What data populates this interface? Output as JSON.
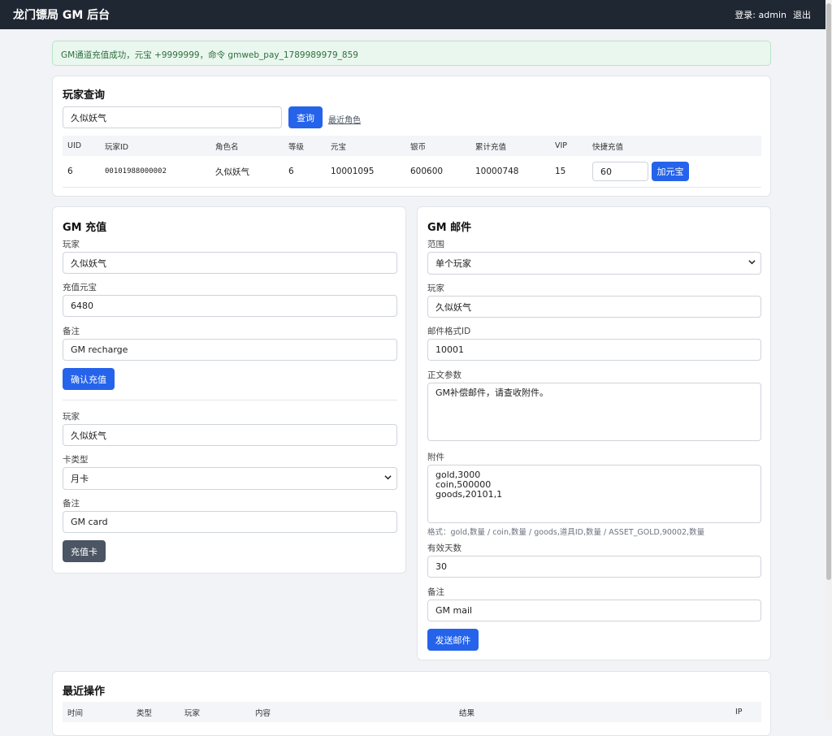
{
  "header": {
    "title": "龙门镖局 GM 后台",
    "login_prefix": "登录:",
    "user": "admin",
    "logout": "退出"
  },
  "alert": {
    "text": "GM通道充值成功，元宝 +9999999，命令 gmweb_pay_1789989979_859"
  },
  "player_query": {
    "title": "玩家查询",
    "search_value": "久似妖气",
    "search_button": "查询",
    "recent_link": "最近角色",
    "columns": [
      "UID",
      "玩家ID",
      "角色名",
      "等级",
      "元宝",
      "银币",
      "累计充值",
      "VIP",
      "快捷充值"
    ],
    "rows": [
      {
        "uid": "6",
        "player_id": "00101988000002",
        "name": "久似妖气",
        "level": "6",
        "yuanbao": "10001095",
        "silver": "600600",
        "total_recharge": "10000748",
        "vip": "15",
        "quick_value": "60",
        "quick_button": "加元宝"
      }
    ]
  },
  "gm_recharge": {
    "title": "GM 充值",
    "player_label": "玩家",
    "player_value": "久似妖气",
    "amount_label": "充值元宝",
    "amount_value": "6480",
    "note_label": "备注",
    "note_value": "GM recharge",
    "confirm_button": "确认充值",
    "card_player_label": "玩家",
    "card_player_value": "久似妖气",
    "card_type_label": "卡类型",
    "card_type_value": "月卡",
    "card_note_label": "备注",
    "card_note_value": "GM card",
    "card_button": "充值卡"
  },
  "gm_mail": {
    "title": "GM 邮件",
    "scope_label": "范围",
    "scope_value": "单个玩家",
    "player_label": "玩家",
    "player_value": "久似妖气",
    "template_label": "邮件格式ID",
    "template_value": "10001",
    "body_label": "正文参数",
    "body_value": "GM补偿邮件，请查收附件。",
    "attach_label": "附件",
    "attach_value": "gold,3000\ncoin,500000\ngoods,20101,1",
    "attach_hint": "格式：gold,数量 / coin,数量 / goods,道具ID,数量 / ASSET_GOLD,90002,数量",
    "days_label": "有效天数",
    "days_value": "30",
    "note_label": "备注",
    "note_value": "GM mail",
    "send_button": "发送邮件"
  },
  "recent_ops": {
    "title": "最近操作",
    "columns": [
      "时间",
      "类型",
      "玩家",
      "内容",
      "结果",
      "IP"
    ]
  }
}
